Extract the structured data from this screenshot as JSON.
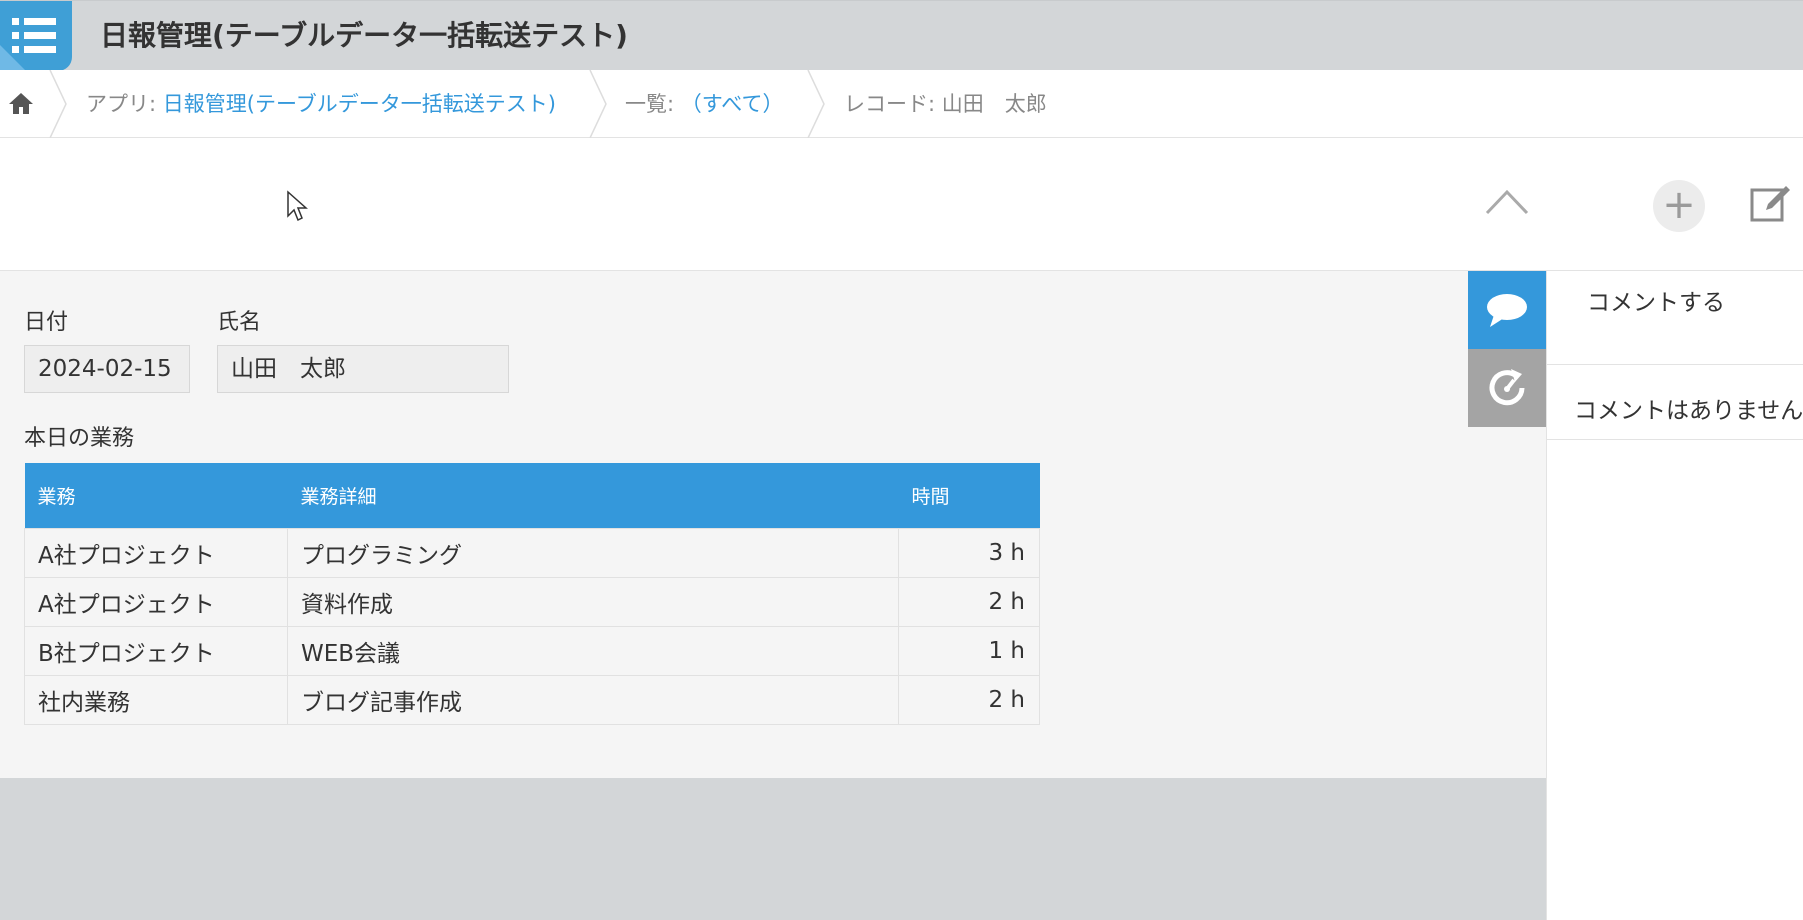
{
  "header": {
    "app_title": "日報管理(テーブルデータ一括転送テスト)"
  },
  "breadcrumb": {
    "app_prefix": "アプリ: ",
    "app_name": "日報管理(テーブルデータ一括転送テスト)",
    "view_prefix": "一覧: ",
    "view_name": "（すべて）",
    "record_label": "レコード: 山田　太郎"
  },
  "record": {
    "date_label": "日付",
    "date_value": "2024-02-15",
    "name_label": "氏名",
    "name_value": "山田　太郎",
    "table_label": "本日の業務",
    "table_headers": [
      "業務",
      "業務詳細",
      "時間"
    ],
    "rows": [
      {
        "task": "A社プロジェクト",
        "detail": "プログラミング",
        "hours": "3 h"
      },
      {
        "task": "A社プロジェクト",
        "detail": "資料作成",
        "hours": "2 h"
      },
      {
        "task": "B社プロジェクト",
        "detail": "WEB会議",
        "hours": "1 h"
      },
      {
        "task": "社内業務",
        "detail": "ブログ記事作成",
        "hours": "2 h"
      }
    ]
  },
  "comments": {
    "post_label": "コメントする",
    "empty_message": "コメントはありません"
  },
  "icons": {
    "app": "list-icon",
    "home": "home-icon",
    "collapse": "chevron-up-icon",
    "add": "plus-icon",
    "edit": "edit-icon",
    "comment_tab": "speech-bubble-icon",
    "history_tab": "history-icon"
  },
  "colors": {
    "accent": "#3498db",
    "topbar": "#d3d6d8",
    "history_tab": "#a4a4a4"
  }
}
